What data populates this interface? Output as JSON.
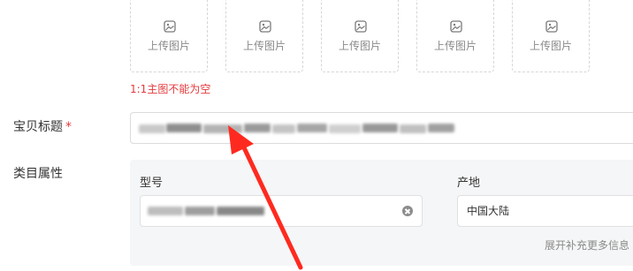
{
  "upload": {
    "slots": [
      {
        "label": "上传图片",
        "icon": "image-icon"
      },
      {
        "label": "上传图片",
        "icon": "image-icon"
      },
      {
        "label": "上传图片",
        "icon": "image-icon"
      },
      {
        "label": "上传图片",
        "icon": "image-icon"
      },
      {
        "label": "上传图片",
        "icon": "image-icon"
      }
    ],
    "error": "1:1主图不能为空"
  },
  "title_row": {
    "label": "宝贝标题",
    "required_mark": "*"
  },
  "attributes": {
    "label": "类目属性",
    "fields": [
      {
        "label": "型号",
        "value": ""
      },
      {
        "label": "产地",
        "value": "中国大陆"
      }
    ],
    "expand_link": "展开补充更多信息"
  },
  "colors": {
    "error": "#e4393c",
    "annotation_arrow": "#ff2a1f",
    "panel_bg": "#f5f6f7"
  }
}
